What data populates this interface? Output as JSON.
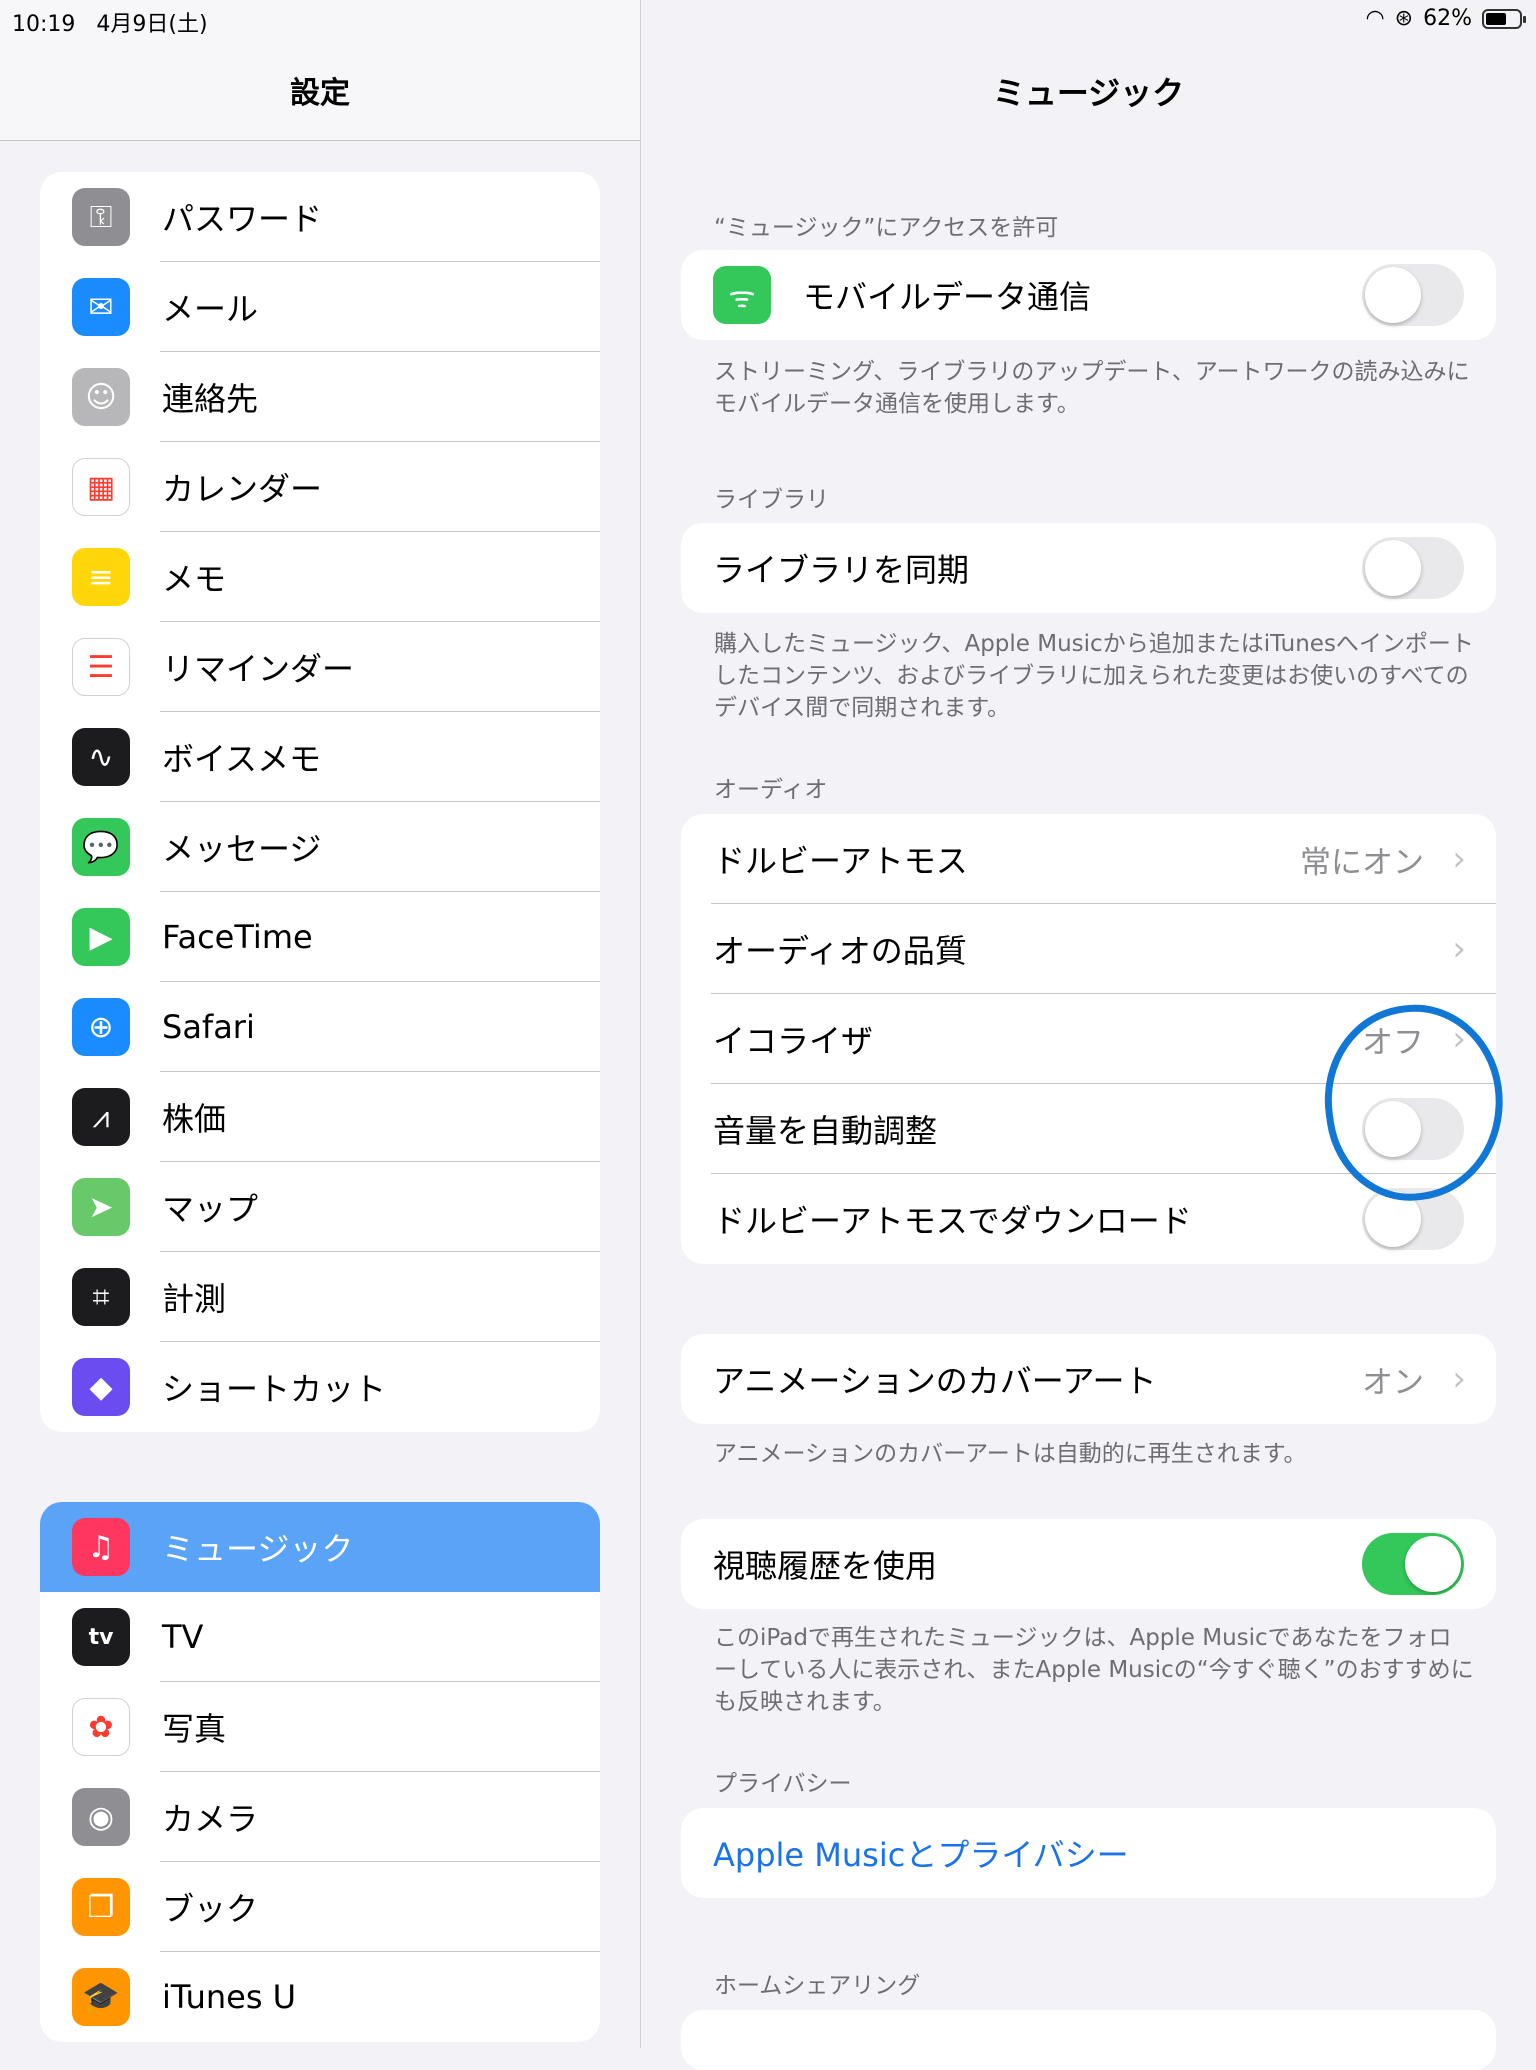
{
  "status_bar": {
    "time": "10:19",
    "date": "4月9日(土)",
    "battery": "62%",
    "battery_level": 0.62
  },
  "sidebar": {
    "title": "設定",
    "group1": [
      {
        "label": "パスワード",
        "icon": "key-icon",
        "color": "#8e8e93",
        "glyph": "⚿"
      },
      {
        "label": "メール",
        "icon": "mail-icon",
        "color": "#1a8cff",
        "glyph": "✉"
      },
      {
        "label": "連絡先",
        "icon": "contacts-icon",
        "color": "#b7b7b9",
        "glyph": "☺"
      },
      {
        "label": "カレンダー",
        "icon": "calendar-icon",
        "color": "#ffffff",
        "glyph": "▦"
      },
      {
        "label": "メモ",
        "icon": "notes-icon",
        "color": "#ffd60a",
        "glyph": "≡"
      },
      {
        "label": "リマインダー",
        "icon": "reminders-icon",
        "color": "#ffffff",
        "glyph": "☰"
      },
      {
        "label": "ボイスメモ",
        "icon": "voice-memos-icon",
        "color": "#1c1c1e",
        "glyph": "∿"
      },
      {
        "label": "メッセージ",
        "icon": "messages-icon",
        "color": "#34c759",
        "glyph": "💬"
      },
      {
        "label": "FaceTime",
        "icon": "facetime-icon",
        "color": "#34c759",
        "glyph": "▶"
      },
      {
        "label": "Safari",
        "icon": "safari-icon",
        "color": "#1a8cff",
        "glyph": "⊕"
      },
      {
        "label": "株価",
        "icon": "stocks-icon",
        "color": "#1c1c1e",
        "glyph": "⩘"
      },
      {
        "label": "マップ",
        "icon": "maps-icon",
        "color": "#68c96a",
        "glyph": "➤"
      },
      {
        "label": "計測",
        "icon": "measure-icon",
        "color": "#1c1c1e",
        "glyph": "⌗"
      },
      {
        "label": "ショートカット",
        "icon": "shortcuts-icon",
        "color": "#6b4cf0",
        "glyph": "◆"
      }
    ],
    "group2": [
      {
        "label": "ミュージック",
        "icon": "music-icon",
        "color": "#ff375f",
        "glyph": "♫",
        "selected": true
      },
      {
        "label": "TV",
        "icon": "tv-icon",
        "color": "#1c1c1e",
        "glyph": "tv"
      },
      {
        "label": "写真",
        "icon": "photos-icon",
        "color": "#ffffff",
        "glyph": "✿"
      },
      {
        "label": "カメラ",
        "icon": "camera-icon",
        "color": "#8e8e93",
        "glyph": "◉"
      },
      {
        "label": "ブック",
        "icon": "books-icon",
        "color": "#ff9500",
        "glyph": "❐"
      },
      {
        "label": "iTunes U",
        "icon": "itunes-u-icon",
        "color": "#ff9500",
        "glyph": "🎓"
      }
    ]
  },
  "detail": {
    "title": "ミュージック",
    "section_access_header": "“ミュージック”にアクセスを許可",
    "mobile_data": {
      "label": "モバイルデータ通信",
      "on": false
    },
    "mobile_data_footer": "ストリーミング、ライブラリのアップデート、アートワークの読み込みにモバイルデータ通信を使用します。",
    "section_library_header": "ライブラリ",
    "sync_library": {
      "label": "ライブラリを同期",
      "on": false
    },
    "sync_library_footer": "購入したミュージック、Apple Musicから追加またはiTunesへインポートしたコンテンツ、およびライブラリに加えられた変更はお使いのすべてのデバイス間で同期されます。",
    "section_audio_header": "オーディオ",
    "dolby_atmos": {
      "label": "ドルビーアトモス",
      "value": "常にオン"
    },
    "audio_quality": {
      "label": "オーディオの品質"
    },
    "eq": {
      "label": "イコライザ",
      "value": "オフ"
    },
    "sound_check": {
      "label": "音量を自動調整",
      "on": false
    },
    "dolby_download": {
      "label": "ドルビーアトモスでダウンロード",
      "on": false
    },
    "animated_art": {
      "label": "アニメーションのカバーアート",
      "value": "オン"
    },
    "animated_art_footer": "アニメーションのカバーアートは自動的に再生されます。",
    "listening_history": {
      "label": "視聴履歴を使用",
      "on": true
    },
    "listening_history_footer": "このiPadで再生されたミュージックは、Apple Musicであなたをフォローしている人に表示され、またApple Musicの“今すぐ聴く”のおすすめにも反映されます。",
    "section_privacy_header": "プライバシー",
    "privacy_link": "Apple Musicとプライバシー",
    "section_home_sharing_header": "ホームシェアリング"
  },
  "annotation_color": "#1177d6"
}
